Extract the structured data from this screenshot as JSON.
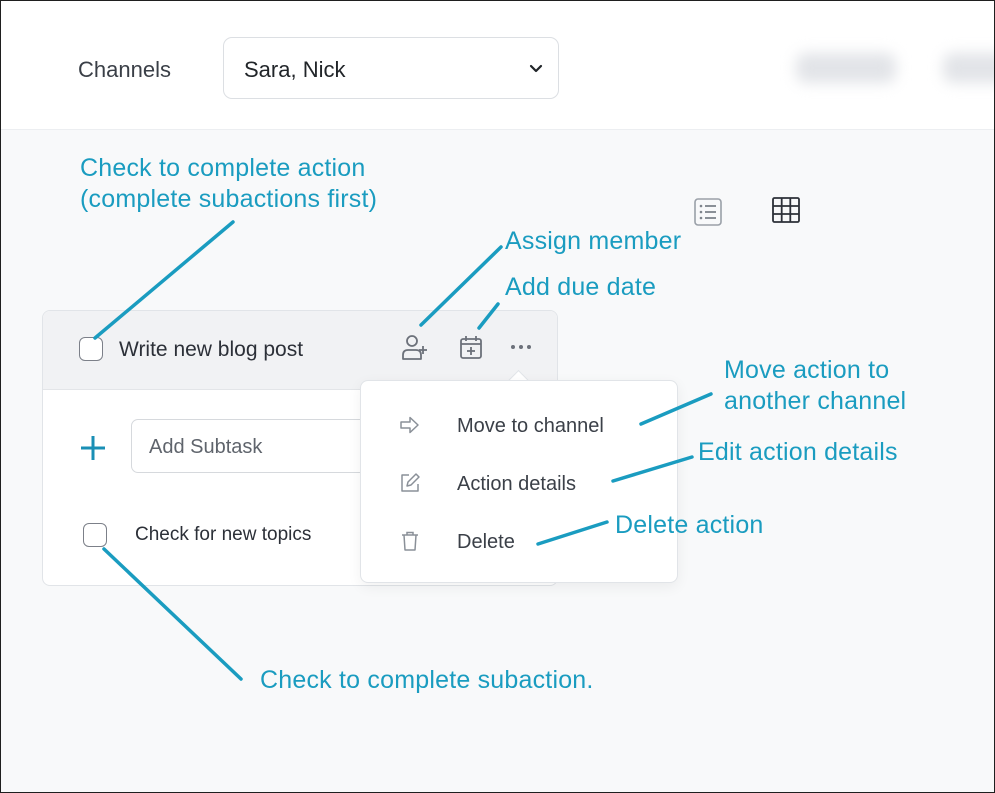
{
  "header": {
    "channels_label": "Channels",
    "channel_select_value": "Sara, Nick"
  },
  "view_toggle": {
    "list_icon": "list-view-icon",
    "grid_icon": "grid-view-icon"
  },
  "action_card": {
    "title": "Write new blog post",
    "add_subtask_placeholder": "Add Subtask",
    "subtask_text": "Check for new topics",
    "icons": [
      "assign-member-icon",
      "add-due-date-icon",
      "more-options-icon"
    ]
  },
  "context_menu": {
    "items": [
      {
        "label": "Move to channel",
        "icon": "arrow-right-icon"
      },
      {
        "label": "Action details",
        "icon": "edit-icon"
      },
      {
        "label": "Delete",
        "icon": "trash-icon"
      }
    ]
  },
  "annotations": {
    "complete_action_line1": "Check to complete action",
    "complete_action_line2": "(complete subactions first)",
    "assign_member": "Assign member",
    "add_due_date": "Add due date",
    "move_action_line1": "Move action to",
    "move_action_line2": "another channel",
    "edit_details": "Edit action details",
    "delete_action": "Delete action",
    "complete_subaction": "Check to complete subaction."
  },
  "colors": {
    "annotation": "#1a9cc0",
    "accent": "#1a8fb5",
    "text": "#2c3038",
    "icon": "#6c717a"
  }
}
